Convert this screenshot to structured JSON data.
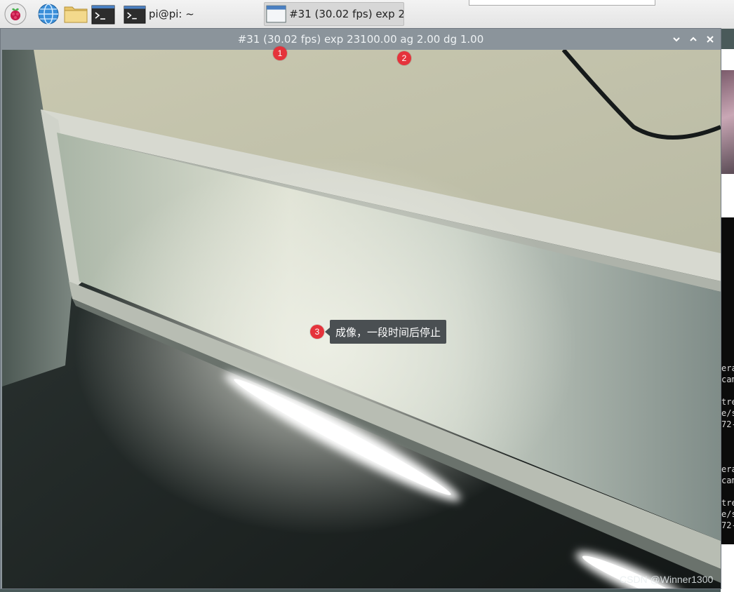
{
  "taskbar": {
    "terminal_task": "pi@pi: ~",
    "camera_task": "#31 (30.02 fps) exp 2..."
  },
  "background_terminal": {
    "lines": [
      "era",
      "cam",
      "tre",
      "e/s",
      "72-",
      "era",
      "cam",
      "tre",
      "e/s",
      "72-"
    ]
  },
  "camera_window": {
    "title": "#31 (30.02 fps) exp 23100.00 ag 2.00 dg 1.00",
    "controls": {
      "minimize": "˅",
      "maximize": "˄",
      "close": "✕"
    }
  },
  "annotations": {
    "badge_1": "1",
    "badge_2": "2",
    "badge_3": "3",
    "note_3": "成像，一段时间后停止"
  },
  "watermark": "CSDN @Winner1300",
  "colors": {
    "titlebar": "#8b949b",
    "badge": "#e5333b",
    "tooltip": "#4a4f52"
  },
  "icons": [
    "raspberry-icon",
    "globe-icon",
    "folder-icon",
    "terminal-icon",
    "window-icon",
    "chevron-down-icon",
    "chevron-up-icon",
    "close-icon"
  ]
}
